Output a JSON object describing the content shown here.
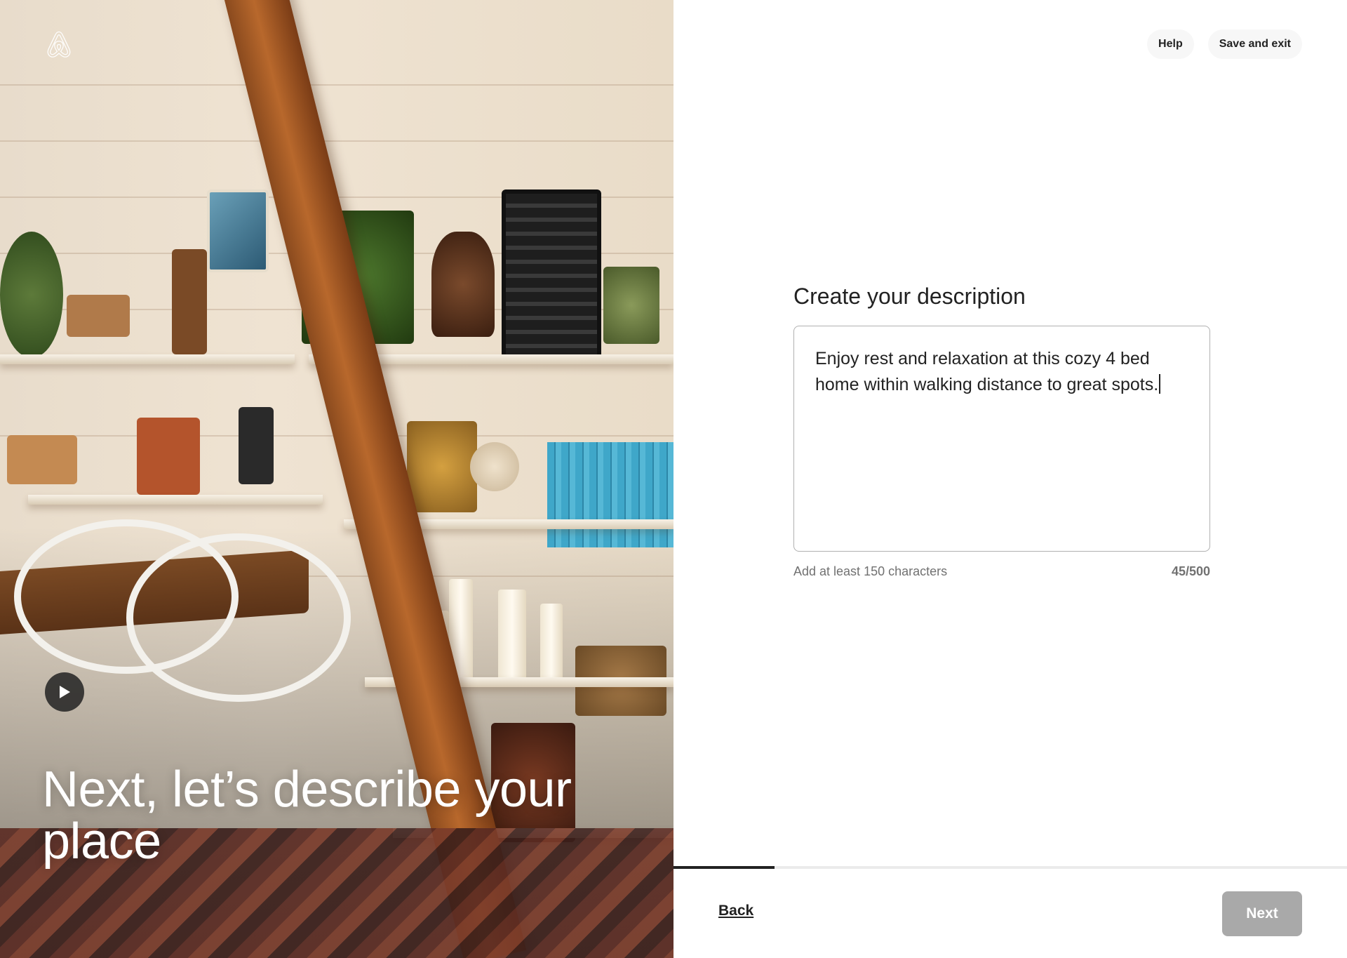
{
  "brand": {
    "logo_icon": "airbnb-logo-icon"
  },
  "hero": {
    "title": "Next, let’s describe your place",
    "play_icon": "play-icon"
  },
  "header": {
    "help_label": "Help",
    "save_exit_label": "Save and exit"
  },
  "form": {
    "title": "Create your description",
    "description_value": "Enjoy rest and relaxation at this cozy 4 bed home within walking distance to great spots.",
    "hint": "Add at least 150 characters",
    "char_count": "45/500"
  },
  "footer": {
    "back_label": "Back",
    "next_label": "Next",
    "progress_fraction": 0.15
  },
  "colors": {
    "text": "#222222",
    "muted": "#717171",
    "next_disabled_bg": "#a9a9a9",
    "pill_bg": "#f7f7f7"
  }
}
